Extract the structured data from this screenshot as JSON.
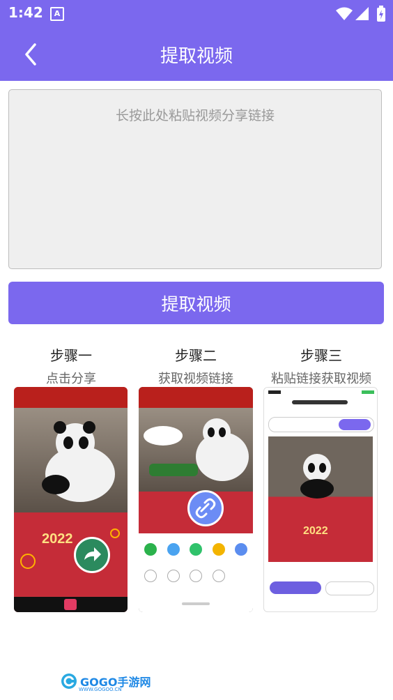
{
  "status_bar": {
    "time": "1:42",
    "a_icon_letter": "A"
  },
  "header": {
    "title": "提取视频"
  },
  "paste_box": {
    "placeholder": "长按此处粘贴视频分享链接"
  },
  "extract_button": {
    "label": "提取视频"
  },
  "steps": [
    {
      "title": "步骤一",
      "subtitle": "点击分享"
    },
    {
      "title": "步骤二",
      "subtitle": "获取视频链接"
    },
    {
      "title": "步骤三",
      "subtitle": "粘贴链接获取视频"
    }
  ],
  "watermark": {
    "brand": "GOGO手游网",
    "url": "WWW.GOGOO.CN"
  },
  "colors": {
    "primary": "#7b68ee",
    "input_bg": "#efefef"
  }
}
